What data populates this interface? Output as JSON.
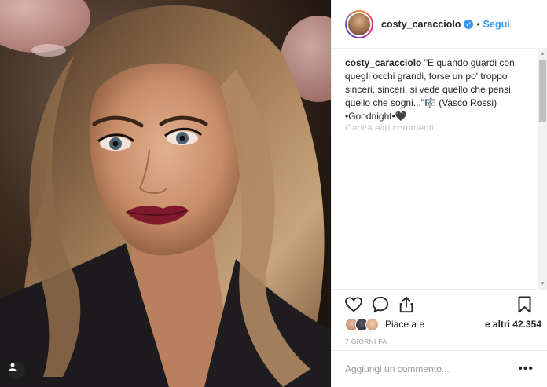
{
  "post": {
    "username": "costy_caracciolo",
    "verified": true,
    "follow_label": "Segui",
    "separator": "•"
  },
  "caption": {
    "username": "costy_caracciolo",
    "text": "\"E quando guardi con quegli occhi grandi, forse un po' troppo sinceri, sinceri, si vede quello che pensi, quello che sogni...\"🎼 (Vasco Rossi) •Goodnight•🖤",
    "load_more": "Carica altri commenti"
  },
  "actions": {
    "like_icon": "heart-icon",
    "comment_icon": "comment-icon",
    "share_icon": "share-icon",
    "save_icon": "bookmark-icon"
  },
  "likes": {
    "prefix": "Piace a e",
    "count": "e altri 42.354"
  },
  "timestamp": "7 GIORNI FA",
  "comment_box": {
    "placeholder": "Aggiungi un commento...",
    "options": "•••"
  },
  "colors": {
    "accent": "#3897f0",
    "text": "#262626",
    "muted": "#999999",
    "border": "#efefef"
  }
}
